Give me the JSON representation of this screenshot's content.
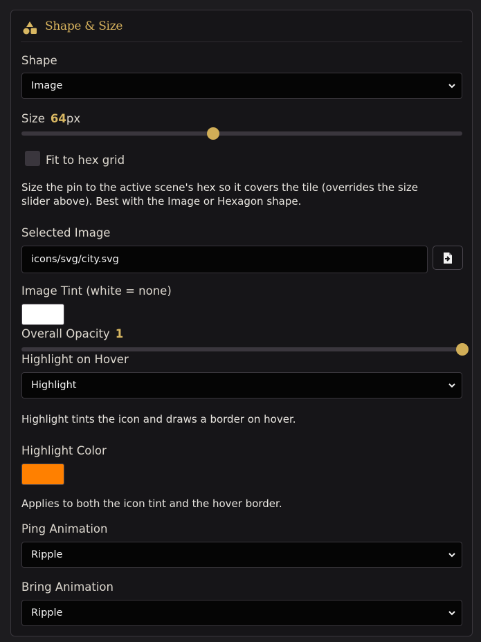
{
  "panel": {
    "title": "Shape & Size",
    "icon": "shapes-icon"
  },
  "shape": {
    "label": "Shape",
    "value": "Image"
  },
  "size": {
    "label": "Size",
    "value": "64",
    "unit": "px",
    "fraction": 0.435
  },
  "fit_hex": {
    "label": "Fit to hex grid",
    "checked": false,
    "help_line1": "Size the pin to the active scene's hex so it covers the tile (overrides the size",
    "help_line2": "slider above). Best with the Image or Hexagon shape."
  },
  "selected_image": {
    "label": "Selected Image",
    "value": "icons/svg/city.svg",
    "button_icon": "file-import-icon"
  },
  "image_tint": {
    "label": "Image Tint (white = none)",
    "color": "#ffffff"
  },
  "opacity": {
    "label": "Overall Opacity",
    "value": "1",
    "fraction": 1.0
  },
  "hover": {
    "label": "Highlight on Hover",
    "value": "Highlight",
    "help": "Highlight tints the icon and draws a border on hover."
  },
  "highlight_color": {
    "label": "Highlight Color",
    "color": "#ff8000",
    "help": "Applies to both the icon tint and the hover border."
  },
  "ping": {
    "label": "Ping Animation",
    "value": "Ripple"
  },
  "bring": {
    "label": "Bring Animation",
    "value": "Ripple"
  },
  "colors": {
    "accent": "#d8b762",
    "panel_bg": "#161518",
    "input_bg": "#050505"
  }
}
